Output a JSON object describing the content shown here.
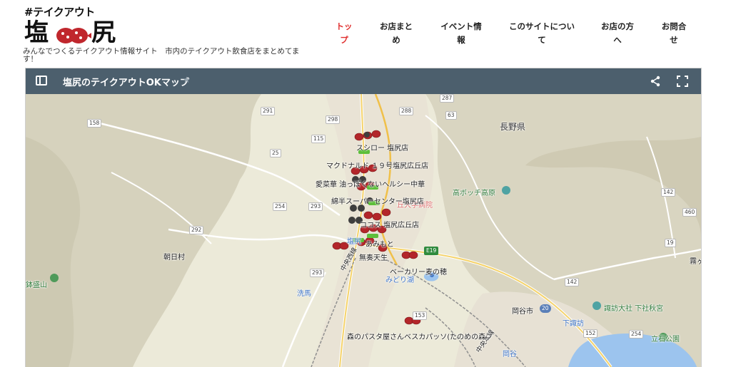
{
  "header": {
    "logo_hash": "#テイクアウト",
    "logo_char1": "塩",
    "logo_char2": "尻",
    "tagline": "みんなでつくるテイクアウト情報サイト　市内のテイクアウト飲食店をまとめてます！"
  },
  "nav": {
    "items": [
      {
        "line1": "トッ",
        "line2": "プ"
      },
      {
        "line1": "お店まと",
        "line2": "め"
      },
      {
        "line1": "イベント情",
        "line2": "報"
      },
      {
        "line1": "このサイトについ",
        "line2": "て"
      },
      {
        "line1": "お店の方",
        "line2": "へ"
      },
      {
        "line1": "お問合",
        "line2": "せ"
      }
    ]
  },
  "map": {
    "title": "塩尻のテイクアウトOKマップ",
    "star": "★",
    "places": {
      "nagano": "長野県",
      "takabocchi": "高ボッチ高原",
      "asahi": "朝日村",
      "hachimori": "鉢盛山",
      "senba": "洗馬",
      "okaya": "岡谷市",
      "suwataisha": "諏訪大社 下社秋宮",
      "shimosuwa": "下諏訪",
      "tateishi": "立石公園",
      "midorigo": "みどり湖",
      "kiri": "霧ヶ",
      "hospital": "丘大学病院",
      "chuo_nishi": "中央西線",
      "chuo_hon": "中央本線",
      "jr_okaya": "岡谷",
      "shio": "塩尻"
    },
    "shops": [
      "スシロー 塩尻店",
      "マクドナルド １９号塩尻広丘店",
      "愛菜華 油っぽくないヘルシー中華",
      "綿半スーパーセンター塩尻店",
      "ココス 塩尻広丘店",
      "あみもと",
      "無奏天生",
      "ベーカリー麦の穂",
      "森のパスタ屋さんベスカパッソ(たのめの森フ"
    ],
    "routes": [
      "287",
      "291",
      "158",
      "298",
      "115",
      "288",
      "63",
      "25",
      "293",
      "254",
      "153",
      "292",
      "E19",
      "20",
      "460",
      "142",
      "19",
      "152",
      "254"
    ]
  },
  "colors": {
    "active_nav": "#e0302f",
    "map_bar": "#4c5f6d",
    "map_land": "#ecead9",
    "water": "#9cc4ee",
    "marker_red": "#b3262a",
    "marker_green": "#5cbf3a"
  }
}
